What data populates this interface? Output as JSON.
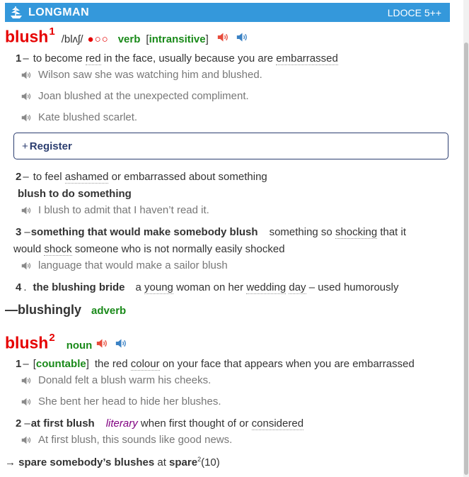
{
  "header": {
    "brand": "LONGMAN",
    "edition": "LDOCE 5++"
  },
  "entry1": {
    "headword": "blush",
    "homnum": "1",
    "pron": "/blʌʃ/",
    "freq": "●○○",
    "pos": "verb",
    "gram_open": "[",
    "gram": "intransitive",
    "gram_close": "]",
    "sense1": {
      "num": "1",
      "dash": "–",
      "def_a": "to become",
      "def_red": "red",
      "def_b": "in the face, usually because you are",
      "def_emb": "embarrassed",
      "examples": [
        "Wilson saw she was watching him and blushed.",
        "Joan blushed at the unexpected compliment.",
        "Kate blushed scarlet."
      ]
    },
    "register_button": {
      "plus": "+",
      "label": "Register"
    },
    "sense2": {
      "num": "2",
      "dash": "–",
      "def_a": "to feel",
      "def_ashamed": "ashamed",
      "def_b": "or embarrassed about something",
      "pattern": "blush to do something",
      "example": "I blush to admit that I haven’t read it."
    },
    "sense3": {
      "num": "3",
      "dash": "–",
      "signpost": "something that would make somebody blush",
      "def_a": "something so",
      "def_shocking": "shocking",
      "def_b": "that it",
      "def_c": "would",
      "def_shock": "shock",
      "def_d": "someone who is not normally easily shocked",
      "example": "language that would make a sailor blush"
    },
    "sense4": {
      "num": "4",
      "dot": ".",
      "phrase": "the blushing bride",
      "def_a": "a",
      "def_young": "young",
      "def_b": "woman on her",
      "def_wedding": "wedding",
      "def_day": "day",
      "def_c": "– used humorously"
    },
    "runon": {
      "dash": "—",
      "word": "blushingly",
      "pos": "adverb"
    }
  },
  "entry2": {
    "headword": "blush",
    "homnum": "2",
    "pos": "noun",
    "sense1": {
      "num": "1",
      "dash": "–",
      "gram_open": "[",
      "gram": "countable",
      "gram_close": "]",
      "def_a": "the red",
      "def_colour": "colour",
      "def_b": "on your face that appears when you are embarrassed",
      "examples": [
        "Donald felt a blush warm his cheeks.",
        "She bent her head to hide her blushes."
      ]
    },
    "sense2": {
      "num": "2",
      "dash": "–",
      "phrase": "at first blush",
      "register": "literary",
      "def_a": "when first thought of or",
      "def_considered": "considered",
      "example": "At first blush, this sounds like good news."
    },
    "crossref": {
      "arrow": "→",
      "phrase": "spare somebody’s blushes",
      "at": "at",
      "target": "spare",
      "target_sup": "2",
      "target_sense": "(10)"
    }
  },
  "colors": {
    "header_bg": "#3498db",
    "headword": "#e60000",
    "pos": "#1a8a1a",
    "register_border": "#2c3e70",
    "speaker_red": "#e74c3c",
    "speaker_blue": "#3b82c4",
    "example_text": "#777777"
  }
}
